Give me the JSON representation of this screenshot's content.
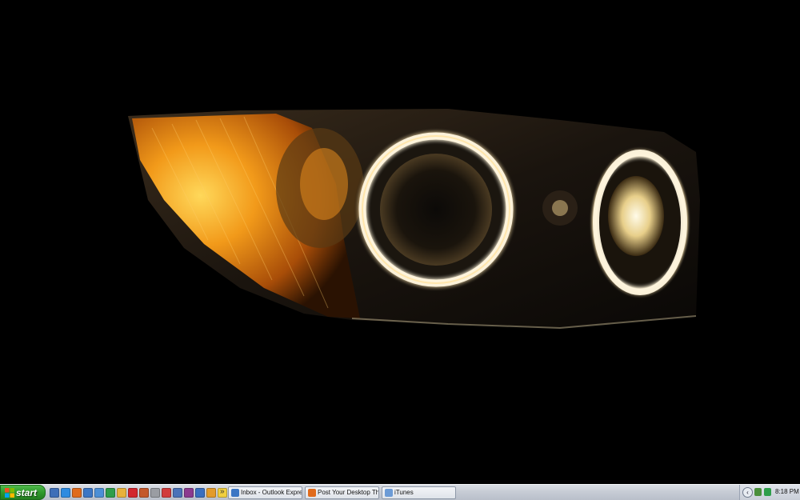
{
  "taskbar": {
    "start_label": "start",
    "start_icon": "windows-logo-icon",
    "quicklaunch": [
      {
        "name": "show-desktop-icon",
        "color": "#3f6fb8"
      },
      {
        "name": "internet-explorer-icon",
        "color": "#2d8be0"
      },
      {
        "name": "firefox-icon",
        "color": "#e06b1c"
      },
      {
        "name": "outlook-express-icon",
        "color": "#3b76c4"
      },
      {
        "name": "windows-media-icon",
        "color": "#4c8fd6"
      },
      {
        "name": "messenger-icon",
        "color": "#2e9e4a"
      },
      {
        "name": "folder-icon",
        "color": "#e8b23a"
      },
      {
        "name": "opera-icon",
        "color": "#d2272e"
      },
      {
        "name": "globe-icon",
        "color": "#c4582a"
      },
      {
        "name": "music-icon",
        "color": "#9a9da3"
      },
      {
        "name": "app-red-icon",
        "color": "#d13b3b"
      },
      {
        "name": "app-window-icon",
        "color": "#4a72b8"
      },
      {
        "name": "winrar-icon",
        "color": "#8b3b8f"
      },
      {
        "name": "app-blue-icon",
        "color": "#3a6fc0"
      },
      {
        "name": "app-orange-icon",
        "color": "#e39b2a"
      },
      {
        "name": "app-yellow-icon",
        "color": "#f1cf3e"
      }
    ],
    "quicklaunch_chevron": "»",
    "windows": [
      {
        "label": "Inbox - Outlook Express",
        "icon": "outlook-express-icon",
        "color": "#3b76c4"
      },
      {
        "label": "Post Your Desktop Th...",
        "icon": "firefox-icon",
        "color": "#e06b1c"
      },
      {
        "label": "iTunes",
        "icon": "itunes-icon",
        "color": "#6c9bd6"
      }
    ],
    "tray": {
      "chevron": "‹",
      "icons": [
        {
          "name": "tray-network-icon",
          "color": "#4a8f3b"
        },
        {
          "name": "tray-messenger-icon",
          "color": "#2e9e4a"
        }
      ],
      "clock": "8:18 PM"
    }
  }
}
